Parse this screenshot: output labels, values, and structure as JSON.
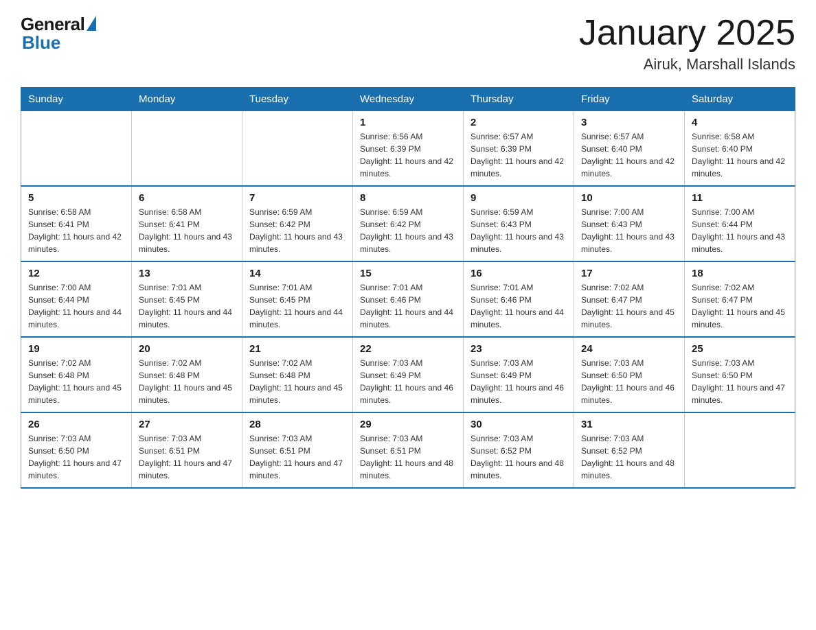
{
  "header": {
    "logo": {
      "general": "General",
      "blue": "Blue"
    },
    "title": "January 2025",
    "subtitle": "Airuk, Marshall Islands"
  },
  "calendar": {
    "days_of_week": [
      "Sunday",
      "Monday",
      "Tuesday",
      "Wednesday",
      "Thursday",
      "Friday",
      "Saturday"
    ],
    "weeks": [
      [
        {
          "day": "",
          "info": ""
        },
        {
          "day": "",
          "info": ""
        },
        {
          "day": "",
          "info": ""
        },
        {
          "day": "1",
          "info": "Sunrise: 6:56 AM\nSunset: 6:39 PM\nDaylight: 11 hours and 42 minutes."
        },
        {
          "day": "2",
          "info": "Sunrise: 6:57 AM\nSunset: 6:39 PM\nDaylight: 11 hours and 42 minutes."
        },
        {
          "day": "3",
          "info": "Sunrise: 6:57 AM\nSunset: 6:40 PM\nDaylight: 11 hours and 42 minutes."
        },
        {
          "day": "4",
          "info": "Sunrise: 6:58 AM\nSunset: 6:40 PM\nDaylight: 11 hours and 42 minutes."
        }
      ],
      [
        {
          "day": "5",
          "info": "Sunrise: 6:58 AM\nSunset: 6:41 PM\nDaylight: 11 hours and 42 minutes."
        },
        {
          "day": "6",
          "info": "Sunrise: 6:58 AM\nSunset: 6:41 PM\nDaylight: 11 hours and 43 minutes."
        },
        {
          "day": "7",
          "info": "Sunrise: 6:59 AM\nSunset: 6:42 PM\nDaylight: 11 hours and 43 minutes."
        },
        {
          "day": "8",
          "info": "Sunrise: 6:59 AM\nSunset: 6:42 PM\nDaylight: 11 hours and 43 minutes."
        },
        {
          "day": "9",
          "info": "Sunrise: 6:59 AM\nSunset: 6:43 PM\nDaylight: 11 hours and 43 minutes."
        },
        {
          "day": "10",
          "info": "Sunrise: 7:00 AM\nSunset: 6:43 PM\nDaylight: 11 hours and 43 minutes."
        },
        {
          "day": "11",
          "info": "Sunrise: 7:00 AM\nSunset: 6:44 PM\nDaylight: 11 hours and 43 minutes."
        }
      ],
      [
        {
          "day": "12",
          "info": "Sunrise: 7:00 AM\nSunset: 6:44 PM\nDaylight: 11 hours and 44 minutes."
        },
        {
          "day": "13",
          "info": "Sunrise: 7:01 AM\nSunset: 6:45 PM\nDaylight: 11 hours and 44 minutes."
        },
        {
          "day": "14",
          "info": "Sunrise: 7:01 AM\nSunset: 6:45 PM\nDaylight: 11 hours and 44 minutes."
        },
        {
          "day": "15",
          "info": "Sunrise: 7:01 AM\nSunset: 6:46 PM\nDaylight: 11 hours and 44 minutes."
        },
        {
          "day": "16",
          "info": "Sunrise: 7:01 AM\nSunset: 6:46 PM\nDaylight: 11 hours and 44 minutes."
        },
        {
          "day": "17",
          "info": "Sunrise: 7:02 AM\nSunset: 6:47 PM\nDaylight: 11 hours and 45 minutes."
        },
        {
          "day": "18",
          "info": "Sunrise: 7:02 AM\nSunset: 6:47 PM\nDaylight: 11 hours and 45 minutes."
        }
      ],
      [
        {
          "day": "19",
          "info": "Sunrise: 7:02 AM\nSunset: 6:48 PM\nDaylight: 11 hours and 45 minutes."
        },
        {
          "day": "20",
          "info": "Sunrise: 7:02 AM\nSunset: 6:48 PM\nDaylight: 11 hours and 45 minutes."
        },
        {
          "day": "21",
          "info": "Sunrise: 7:02 AM\nSunset: 6:48 PM\nDaylight: 11 hours and 45 minutes."
        },
        {
          "day": "22",
          "info": "Sunrise: 7:03 AM\nSunset: 6:49 PM\nDaylight: 11 hours and 46 minutes."
        },
        {
          "day": "23",
          "info": "Sunrise: 7:03 AM\nSunset: 6:49 PM\nDaylight: 11 hours and 46 minutes."
        },
        {
          "day": "24",
          "info": "Sunrise: 7:03 AM\nSunset: 6:50 PM\nDaylight: 11 hours and 46 minutes."
        },
        {
          "day": "25",
          "info": "Sunrise: 7:03 AM\nSunset: 6:50 PM\nDaylight: 11 hours and 47 minutes."
        }
      ],
      [
        {
          "day": "26",
          "info": "Sunrise: 7:03 AM\nSunset: 6:50 PM\nDaylight: 11 hours and 47 minutes."
        },
        {
          "day": "27",
          "info": "Sunrise: 7:03 AM\nSunset: 6:51 PM\nDaylight: 11 hours and 47 minutes."
        },
        {
          "day": "28",
          "info": "Sunrise: 7:03 AM\nSunset: 6:51 PM\nDaylight: 11 hours and 47 minutes."
        },
        {
          "day": "29",
          "info": "Sunrise: 7:03 AM\nSunset: 6:51 PM\nDaylight: 11 hours and 48 minutes."
        },
        {
          "day": "30",
          "info": "Sunrise: 7:03 AM\nSunset: 6:52 PM\nDaylight: 11 hours and 48 minutes."
        },
        {
          "day": "31",
          "info": "Sunrise: 7:03 AM\nSunset: 6:52 PM\nDaylight: 11 hours and 48 minutes."
        },
        {
          "day": "",
          "info": ""
        }
      ]
    ]
  }
}
